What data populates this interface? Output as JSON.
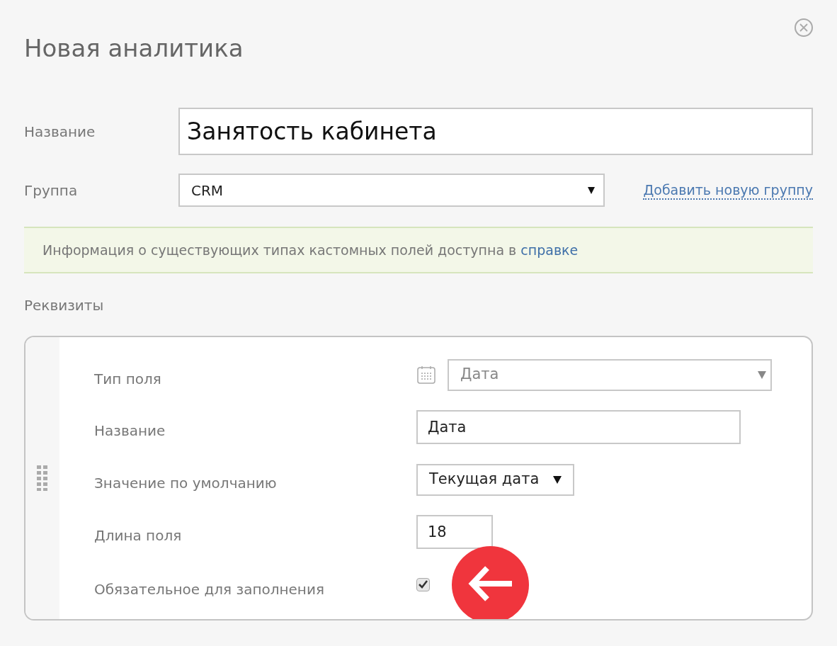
{
  "dialog": {
    "title": "Новая аналитика"
  },
  "name_field": {
    "label": "Название",
    "value": "Занятость кабинета"
  },
  "group_field": {
    "label": "Группа",
    "value": "CRM",
    "add_link": "Добавить новую группу"
  },
  "info_banner": {
    "text": "Информация о существующих типах кастомных полей доступна в ",
    "link": "справке"
  },
  "section_title": "Реквизиты",
  "field_settings": [
    {
      "kind": "type-select",
      "label": "Тип поля",
      "value": "Дата",
      "disabled": true
    },
    {
      "kind": "text",
      "label": "Название",
      "value": "Дата"
    },
    {
      "kind": "select",
      "label": "Значение по умолчанию",
      "value": "Текущая дата",
      "disabled": false
    },
    {
      "kind": "number",
      "label": "Длина поля",
      "value": "18"
    },
    {
      "kind": "checkbox",
      "label": "Обязательное для заполнения",
      "checked": true
    }
  ]
}
